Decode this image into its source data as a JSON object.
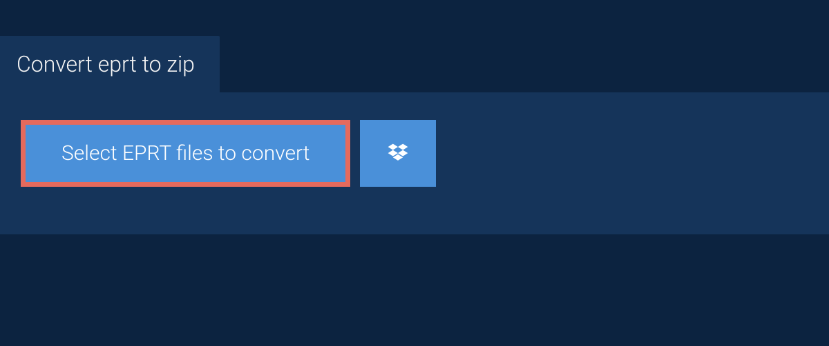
{
  "tab": {
    "title": "Convert eprt to zip"
  },
  "actions": {
    "select_label": "Select EPRT files to convert"
  },
  "colors": {
    "page_bg": "#0c2340",
    "panel_bg": "#15345a",
    "button_bg": "#4a90d9",
    "highlight_border": "#e56a5d",
    "text": "#ffffff"
  },
  "icons": {
    "dropbox": "dropbox-icon"
  }
}
